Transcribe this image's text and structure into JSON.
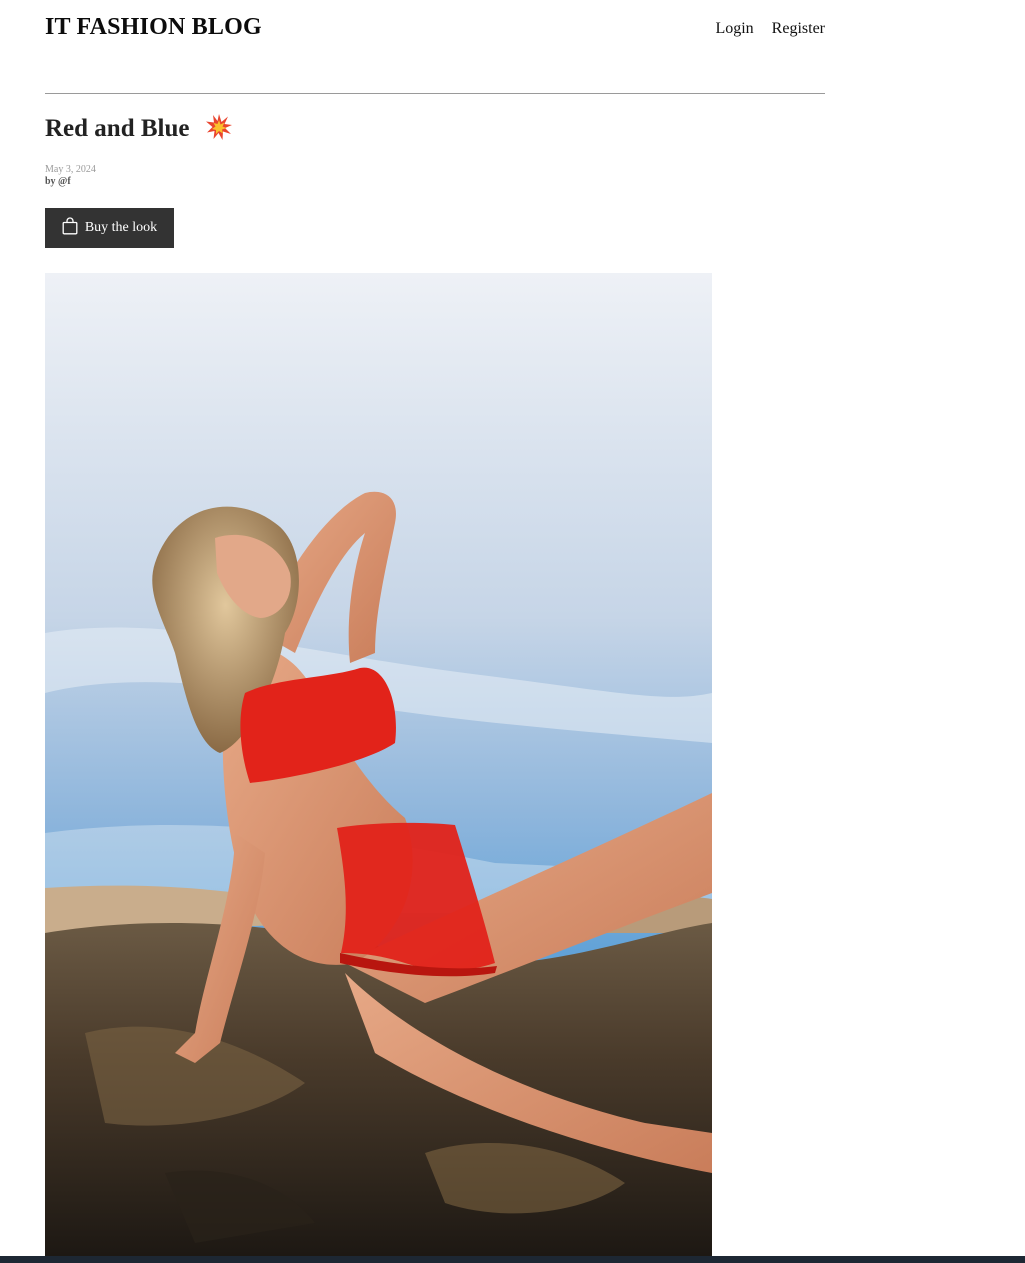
{
  "header": {
    "site_title": "IT FASHION BLOG",
    "nav": {
      "login": "Login",
      "register": "Register"
    }
  },
  "post": {
    "title": "Red and Blue",
    "title_icon": "collision-icon",
    "date": "May 3, 2024",
    "author": "by @f",
    "buy_button": {
      "label": "Buy the look",
      "icon": "shopping-bag-icon"
    }
  },
  "colors": {
    "button_bg": "#333333",
    "divider": "#9a9a9a",
    "bikini_red": "#e2231a",
    "sky_blue": "#4f9ad6"
  }
}
